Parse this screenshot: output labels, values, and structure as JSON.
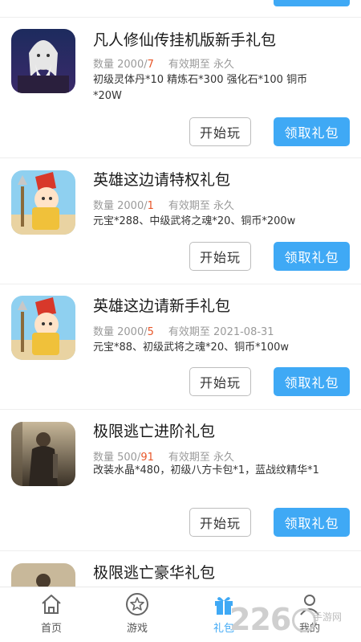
{
  "gifts": [
    {
      "title": "凡人修仙传挂机版新手礼包",
      "meta_prefix": "数量 2000/",
      "remaining": "7",
      "validity": "有效期至 永久",
      "desc": "初级灵体丹*10 精炼石*300 强化石*100 铜币*20W",
      "play_label": "开始玩",
      "claim_label": "领取礼包"
    },
    {
      "title": "英雄这边请特权礼包",
      "meta_prefix": "数量 2000/",
      "remaining": "1",
      "validity": "有效期至 永久",
      "desc": "元宝*288、中级武将之魂*20、铜币*200w",
      "play_label": "开始玩",
      "claim_label": "领取礼包"
    },
    {
      "title": "英雄这边请新手礼包",
      "meta_prefix": "数量 2000/",
      "remaining": "5",
      "validity": "有效期至 2021-08-31",
      "desc": "元宝*88、初级武将之魂*20、铜币*100w",
      "play_label": "开始玩",
      "claim_label": "领取礼包"
    },
    {
      "title": "极限逃亡进阶礼包",
      "meta_prefix": "数量 500/",
      "remaining": "91",
      "validity": "有效期至 永久",
      "desc": "改装水晶*480，初级八方卡包*1，蓝战纹精华*1",
      "play_label": "开始玩",
      "claim_label": "领取礼包"
    },
    {
      "title": "极限逃亡豪华礼包"
    }
  ],
  "nav": {
    "home": "首页",
    "games": "游戏",
    "gifts": "礼包",
    "mine": "我的"
  },
  "watermark": {
    "number": "226",
    "text": "手游网"
  },
  "colors": {
    "accent": "#3fa9f5",
    "remaining": "#e8572a"
  }
}
